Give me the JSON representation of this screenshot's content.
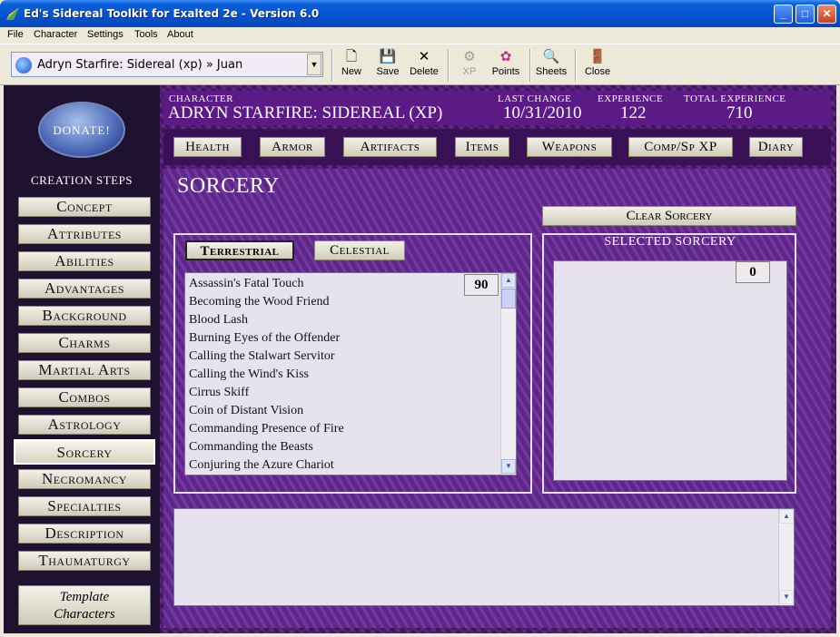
{
  "window": {
    "title": "Ed's Sidereal Toolkit for Exalted 2e - Version 6.0",
    "controls": {
      "minimize": "_",
      "maximize": "□",
      "close": "✕"
    }
  },
  "menu": [
    "File",
    "Character",
    "Settings",
    "Tools",
    "About"
  ],
  "toolbar": {
    "character_select": "Adryn Starfire: Sidereal (xp) » Juan",
    "buttons": [
      {
        "label": "New",
        "icon": "new-document-icon",
        "glyph": "🗋"
      },
      {
        "label": "Save",
        "icon": "floppy-disk-icon",
        "glyph": "💾"
      },
      {
        "label": "Delete",
        "icon": "delete-x-icon",
        "glyph": "✕"
      },
      {
        "label": "XP",
        "icon": "xp-icon",
        "glyph": "⚙",
        "disabled": true
      },
      {
        "label": "Points",
        "icon": "points-icon",
        "glyph": "✿"
      },
      {
        "label": "Sheets",
        "icon": "sheets-icon",
        "glyph": "🔍"
      },
      {
        "label": "Close",
        "icon": "close-door-icon",
        "glyph": "🚪"
      }
    ]
  },
  "sidebar": {
    "donate": "DONATE!",
    "title": "CREATION STEPS",
    "steps": [
      "Concept",
      "Attributes",
      "Abilities",
      "Advantages",
      "Background",
      "Charms",
      "Martial Arts",
      "Combos",
      "Astrology",
      "Sorcery",
      "Necromancy",
      "Specialties",
      "Description",
      "Thaumaturgy"
    ],
    "active_step": "Sorcery",
    "template_line1": "Template",
    "template_line2": "Characters"
  },
  "header": {
    "character_label": "CHARACTER",
    "character_name": "ADRYN STARFIRE: SIDEREAL (XP)",
    "last_change_label": "LAST CHANGE",
    "last_change": "10/31/2010",
    "experience_label": "EXPERIENCE",
    "experience": "122",
    "total_experience_label": "TOTAL EXPERIENCE",
    "total_experience": "710"
  },
  "tabs": [
    "Health",
    "Armor",
    "Artifacts",
    "Items",
    "Weapons",
    "Comp/Sp XP",
    "Diary"
  ],
  "sorcery": {
    "title": "SORCERY",
    "clear_button": "Clear Sorcery",
    "circle_tabs": [
      "Terrestrial",
      "Celestial"
    ],
    "active_circle": "Terrestrial",
    "spell_cost": "90",
    "spells": [
      "Assassin's Fatal Touch",
      "Becoming the Wood Friend",
      "Blood Lash",
      "Burning Eyes of the Offender",
      "Calling the Stalwart Servitor",
      "Calling the Wind's Kiss",
      "Cirrus Skiff",
      "Coin of Distant Vision",
      "Commanding Presence of Fire",
      "Commanding the Beasts",
      "Conjuring the Azure Chariot"
    ],
    "selected_title": "SELECTED SORCERY",
    "selected_total": "0"
  }
}
